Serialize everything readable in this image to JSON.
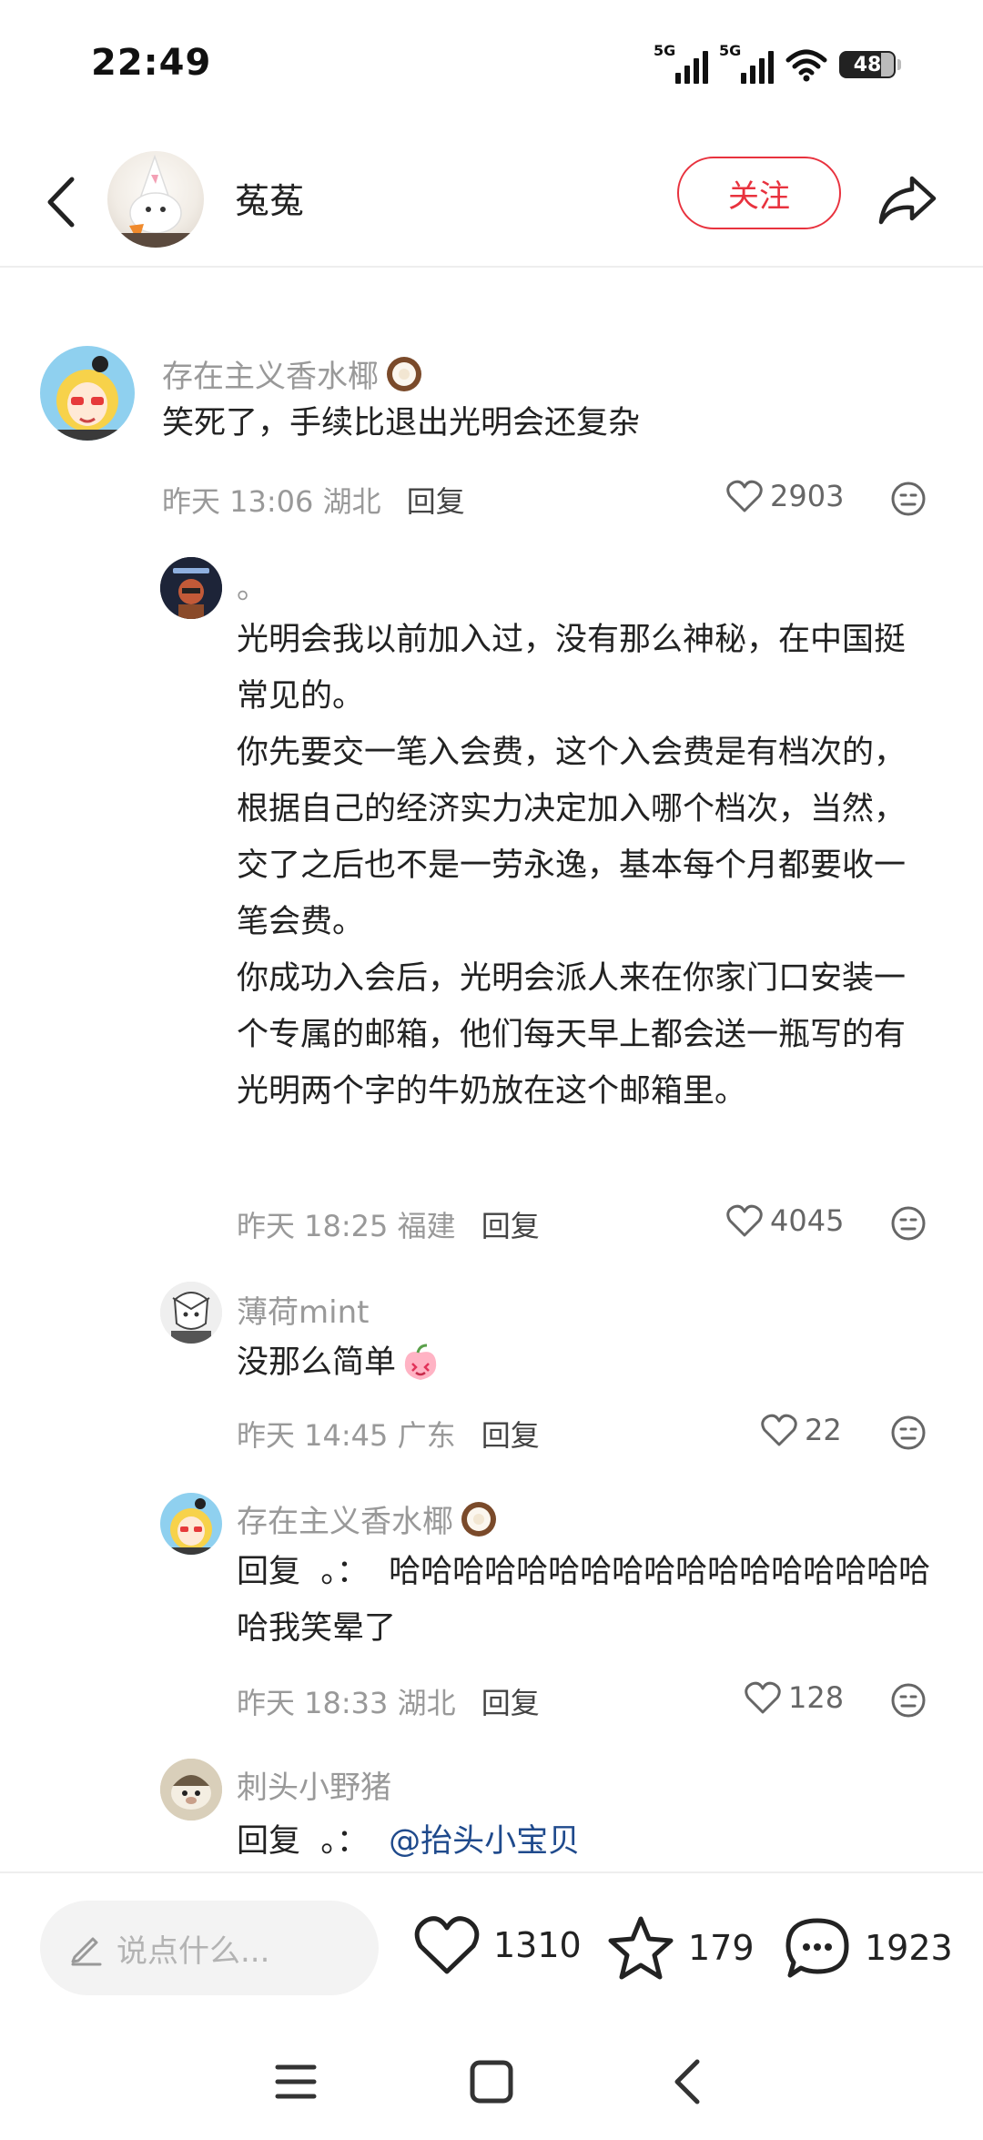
{
  "status_bar": {
    "time": "22:49",
    "network_1": "5G",
    "network_2": "5G",
    "battery": "48"
  },
  "header": {
    "author_name": "菟菟",
    "follow_label": "关注",
    "icons": [
      "back-icon",
      "share-icon"
    ]
  },
  "comments": [
    {
      "name": "存在主义香水椰",
      "name_emoji": "coconut-icon",
      "text": [
        "笑死了，手续比退出光明会还复杂"
      ],
      "time": "昨天 13:06",
      "location": "湖北",
      "reply_label": "回复",
      "likes": "2903"
    },
    {
      "name": "。",
      "text": [
        "光明会我以前加入过，没有那么神秘，在中国挺常见的。",
        "你先要交一笔入会费，这个入会费是有档次的，根据自己的经济实力决定加入哪个档次，当然，交了之后也不是一劳永逸，基本每个月都要收一笔会费。",
        "你成功入会后，光明会派人来在你家门口安装一个专属的邮箱，他们每天早上都会送一瓶写的有光明两个字的牛奶放在这个邮箱里。"
      ],
      "time": "昨天 18:25",
      "location": "福建",
      "reply_label": "回复",
      "likes": "4045"
    },
    {
      "name": "薄荷mint",
      "text": [
        "没那么简单"
      ],
      "text_emoji": "peach-face-icon",
      "time": "昨天 14:45",
      "location": "广东",
      "reply_label": "回复",
      "likes": "22"
    },
    {
      "name": "存在主义香水椰",
      "name_emoji": "coconut-icon",
      "reply_prefix": "回复",
      "reply_to": "。：",
      "text": [
        "哈哈哈哈哈哈哈哈哈哈哈哈哈哈哈哈哈哈我笑晕了"
      ],
      "time": "昨天 18:33",
      "location": "湖北",
      "reply_label": "回复",
      "likes": "128"
    },
    {
      "name": "刺头小野猪",
      "reply_prefix": "回复",
      "reply_to": "。：",
      "mention": "@抬头小宝贝"
    }
  ],
  "bottom_bar": {
    "input_placeholder": "说点什么...",
    "likes": "1310",
    "stars": "179",
    "comments": "1923"
  },
  "nav_bar": {
    "icons": [
      "menu-icon",
      "home-square-icon",
      "back-triangle-icon"
    ]
  },
  "colors": {
    "accent_red": "#e8323e",
    "mention_blue": "#1f4a8c",
    "meta_gray": "#999999"
  }
}
